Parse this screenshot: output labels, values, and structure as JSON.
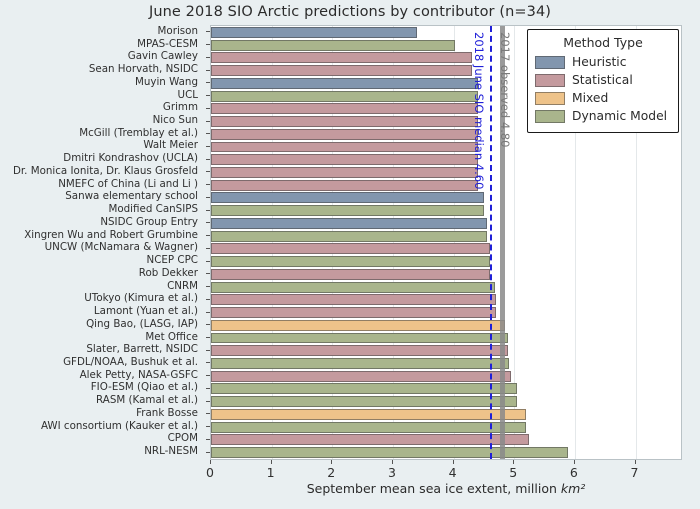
{
  "chart_data": {
    "type": "bar",
    "orientation": "horizontal",
    "title": "June 2018 SIO Arctic predictions by contributor (n=34)",
    "xlabel": "September mean sea ice extent, million km²",
    "ylabel": "",
    "xlim": [
      0,
      7.75
    ],
    "xticks": [
      0,
      1,
      2,
      3,
      4,
      5,
      6,
      7
    ],
    "xticklabels": [
      "0",
      "1",
      "2",
      "3",
      "4",
      "5",
      "6",
      "7"
    ],
    "grid": true,
    "legend_position": "upper right",
    "legend_title": "Method Type",
    "legend_entries": [
      {
        "label": "Heuristic",
        "color": "#8296ae"
      },
      {
        "label": "Statistical",
        "color": "#c49a9e"
      },
      {
        "label": "Mixed",
        "color": "#eec38a"
      },
      {
        "label": "Dynamic Model",
        "color": "#a9b58c"
      }
    ],
    "categories": [
      "Morison",
      "MPAS-CESM",
      "Gavin Cawley",
      "Sean Horvath, NSIDC",
      "Muyin Wang",
      "UCL",
      "Grimm",
      "Nico Sun",
      "McGill (Tremblay et al.)",
      "Walt Meier",
      "Dmitri Kondrashov (UCLA)",
      "Dr. Monica Ionita, Dr. Klaus Grosfeld",
      "NMEFC of China (Li and Li )",
      "Sanwa elementary school",
      "Modified CanSIPS",
      "NSIDC Group Entry",
      "Xingren Wu and Robert Grumbine",
      "UNCW (McNamara & Wagner)",
      "NCEP CPC",
      "Rob Dekker",
      "CNRM",
      "UTokyo (Kimura et al.)",
      "Lamont (Yuan et al.)",
      "Qing Bao, (LASG, IAP)",
      "Met Office",
      "Slater, Barrett, NSIDC",
      "GFDL/NOAA, Bushuk et al.",
      "Alek Petty, NASA-GSFC",
      "FIO-ESM (Qiao et al.)",
      "RASM (Kamal et al.)",
      "Frank Bosse",
      "AWI consortium (Kauker et al.)",
      "CPOM",
      "NRL-NESM"
    ],
    "values": [
      3.4,
      4.02,
      4.3,
      4.3,
      4.4,
      4.4,
      4.4,
      4.4,
      4.4,
      4.4,
      4.4,
      4.4,
      4.4,
      4.5,
      4.5,
      4.55,
      4.55,
      4.6,
      4.6,
      4.6,
      4.68,
      4.7,
      4.7,
      4.85,
      4.9,
      4.9,
      4.92,
      4.95,
      5.05,
      5.05,
      5.2,
      5.2,
      5.25,
      5.88
    ],
    "method_types": [
      "Heuristic",
      "Dynamic Model",
      "Statistical",
      "Statistical",
      "Heuristic",
      "Dynamic Model",
      "Statistical",
      "Statistical",
      "Statistical",
      "Statistical",
      "Statistical",
      "Statistical",
      "Statistical",
      "Heuristic",
      "Dynamic Model",
      "Heuristic",
      "Dynamic Model",
      "Statistical",
      "Dynamic Model",
      "Statistical",
      "Dynamic Model",
      "Statistical",
      "Statistical",
      "Mixed",
      "Dynamic Model",
      "Statistical",
      "Dynamic Model",
      "Statistical",
      "Dynamic Model",
      "Dynamic Model",
      "Mixed",
      "Dynamic Model",
      "Statistical",
      "Dynamic Model"
    ],
    "annotations": [
      {
        "name": "median-line",
        "text": "2018 June SIO median 4.60",
        "value": 4.6,
        "color": "#1f1fd8",
        "style": "dashed"
      },
      {
        "name": "observed-line",
        "text": "2017 observed 4.80",
        "value": 4.8,
        "color": "#8a8a8a",
        "style": "solid"
      }
    ]
  }
}
